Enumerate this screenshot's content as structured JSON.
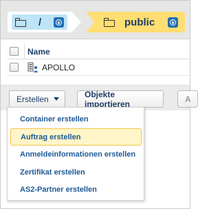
{
  "breadcrumb": {
    "items": [
      {
        "label": "/",
        "icon": "folder-icon",
        "button_icon": "download-icon"
      },
      {
        "label": "public",
        "icon": "folder-icon",
        "button_icon": "download-icon"
      }
    ],
    "colors": {
      "root": "#bfe3f7",
      "current": "#ffde73",
      "accent": "#1f6fb5"
    }
  },
  "table": {
    "columns": [
      "Name"
    ],
    "rows": [
      {
        "name": "APOLLO",
        "icon": "container-user-icon"
      }
    ]
  },
  "toolbar": {
    "create_label": "Erstellen",
    "import_label": "Objekte importieren",
    "cut_label": "A"
  },
  "create_menu": {
    "items": [
      {
        "label": "Container erstellen",
        "active": false
      },
      {
        "label": "Auftrag erstellen",
        "active": true
      },
      {
        "label": "Anmeldeinformationen erstellen",
        "active": false
      },
      {
        "label": "Zertifikat erstellen",
        "active": false
      },
      {
        "label": "AS2-Partner erstellen",
        "active": false
      }
    ]
  }
}
